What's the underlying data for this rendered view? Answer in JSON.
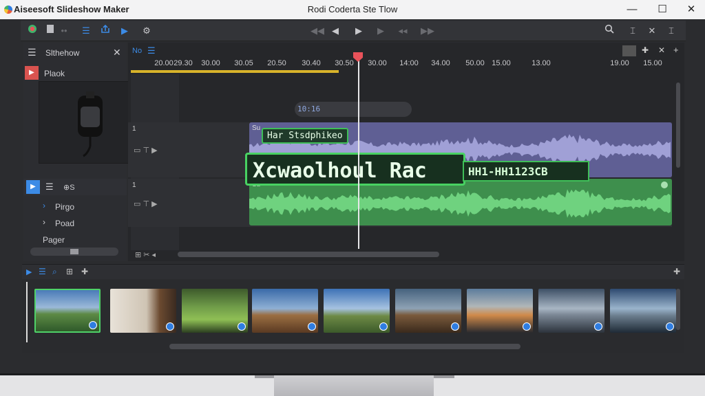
{
  "app": {
    "title": "Aiseesoft Slideshow Maker",
    "window_title": "Rodi Coderta Ste Tlow"
  },
  "window_controls": {
    "minimize": "—",
    "maximize": "☐",
    "close": "✕"
  },
  "left_panel": {
    "header_label": "Slthehow",
    "item1_label": "Plaok",
    "track_items": [
      "Pirgo",
      "Poad"
    ],
    "footer_label": "Pager"
  },
  "timeline": {
    "header_label": "No",
    "ruler_labels": [
      "20.00",
      "29.30",
      "30.00",
      "30.05",
      "20.50",
      "30.40",
      "30.50",
      "30.00",
      "14:00",
      "34.00",
      "50.00",
      "15.00",
      "13.00",
      "19.00",
      "15.00"
    ],
    "track1_number": "1",
    "track2_number": "1",
    "clip1_label": "Su",
    "clip2_label": "Su",
    "floating_label": "10:16",
    "overlay_small": "Har Stsdphikeo",
    "overlay_big": "Xcwaolhoul Rac",
    "overlay_code": "HH1-HH1123CB"
  },
  "colors": {
    "accent_blue": "#3c8be6",
    "clip_purple": "#5f5f94",
    "clip_green": "#3e8f4d",
    "overlay_green": "#48d262",
    "playhead_red": "#e8525a"
  }
}
